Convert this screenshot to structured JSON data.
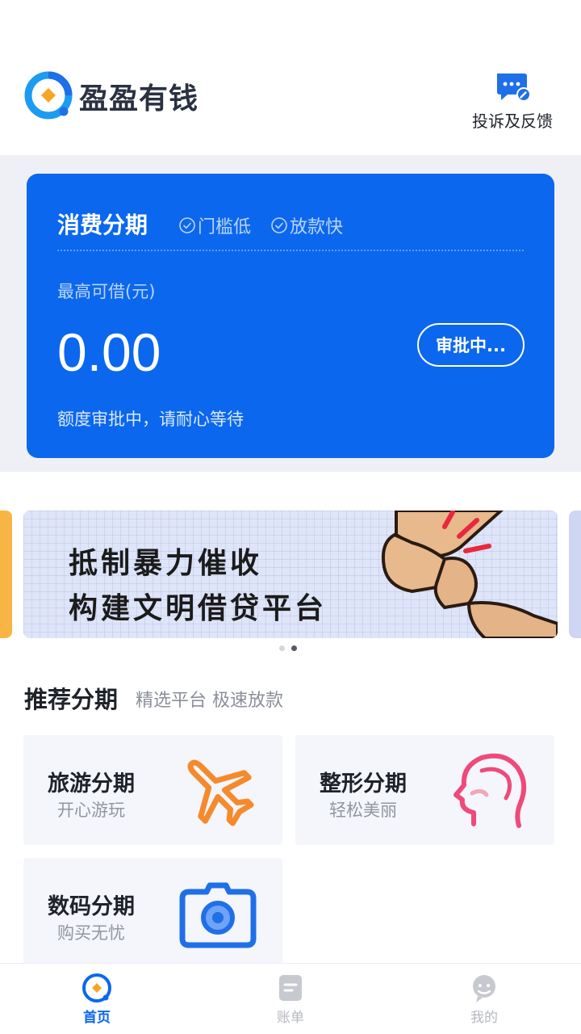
{
  "header": {
    "app_name": "盈盈有钱",
    "feedback_label": "投诉及反馈"
  },
  "card": {
    "title": "消费分期",
    "tags": [
      "门槛低",
      "放款快"
    ],
    "amount_label": "最高可借(元)",
    "amount": "0.00",
    "status_button": "审批中...",
    "wait_text": "额度审批中，请耐心等待"
  },
  "banner": {
    "line1": "抵制暴力催收",
    "line2": "构建文明借贷平台",
    "page_count": 2,
    "active_page": 2
  },
  "recommend": {
    "title": "推荐分期",
    "subtitle": "精选平台 极速放款",
    "items": [
      {
        "title": "旅游分期",
        "subtitle": "开心游玩",
        "icon": "airplane-icon"
      },
      {
        "title": "整形分期",
        "subtitle": "轻松美丽",
        "icon": "face-profile-icon"
      },
      {
        "title": "数码分期",
        "subtitle": "购买无忧",
        "icon": "camera-icon"
      }
    ]
  },
  "tabbar": {
    "tabs": [
      {
        "label": "首页",
        "icon": "home-icon",
        "active": true
      },
      {
        "label": "账单",
        "icon": "bill-icon",
        "active": false
      },
      {
        "label": "我的",
        "icon": "profile-icon",
        "active": false
      }
    ]
  },
  "colors": {
    "primary": "#0b67ee",
    "background_band": "#eef0f5",
    "tile_background": "#f4f6fb",
    "airplane_orange": "#f58a2c",
    "face_pink": "#ee4a7a"
  }
}
